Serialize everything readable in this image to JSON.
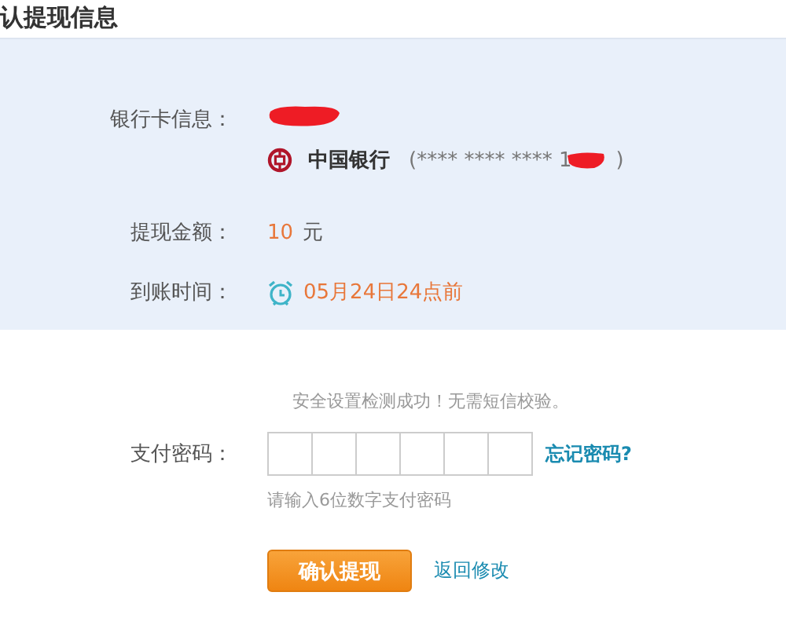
{
  "title": "认提现信息",
  "info": {
    "rows": [
      {
        "kind": "bank",
        "label": "银行卡信息：",
        "bank_name": "中国银行",
        "card_number": "(**** **** **** 1",
        "card_end": ")"
      },
      {
        "kind": "amount",
        "label": "提现金额：",
        "amount": "10",
        "unit": "元"
      },
      {
        "kind": "time",
        "label": "到账时间：",
        "value": "05月24日24点前"
      }
    ]
  },
  "notice": "安全设置检测成功！无需短信校验。",
  "password": {
    "label": "支付密码：",
    "cells": [
      {
        "filled": false
      },
      {
        "filled": false
      },
      {
        "filled": false
      },
      {
        "filled": false
      },
      {
        "filled": false
      },
      {
        "filled": false
      }
    ],
    "forgot_link": "忘记密码?",
    "hint": "请输入6位数字支付密码"
  },
  "buttons": {
    "confirm": "确认提现",
    "back": "返回修改"
  }
}
